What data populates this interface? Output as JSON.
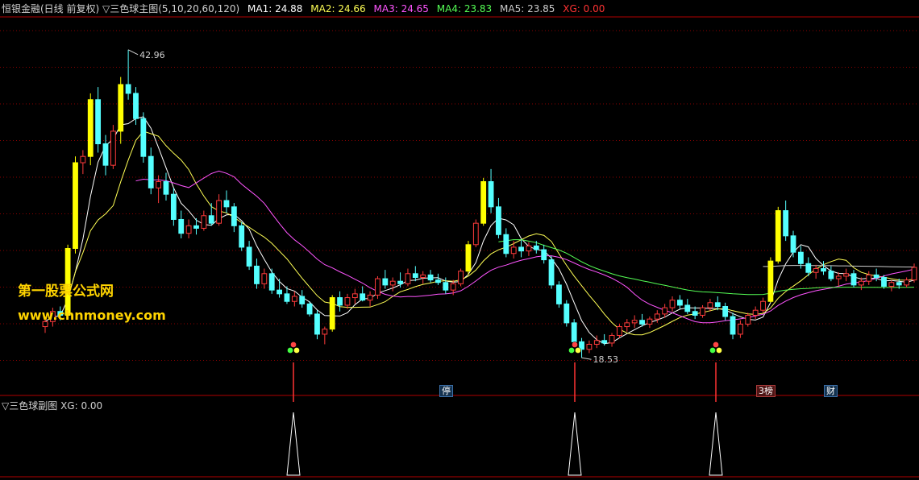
{
  "header": {
    "title": "恒银金融(日线 前复权) ▽三色球主图(5,10,20,60,120)",
    "ma1_label": "MA1: 24.88",
    "ma2_label": "MA2: 24.66",
    "ma3_label": "MA3: 24.65",
    "ma4_label": "MA4: 23.83",
    "ma5_label": "MA5: 23.85",
    "xg_label": "XG: 0.00"
  },
  "sub_header": {
    "title": "▽三色球副图",
    "xg_label": "XG: 0.00"
  },
  "watermark": {
    "line1": "第一股票公式网",
    "line2": "www.chnmoney.com"
  },
  "colors": {
    "up": "#ff3b3b",
    "down": "#55ffff",
    "yellow_candle": "#ffff00",
    "ma1": "#ffffff",
    "ma2": "#ffff55",
    "ma3": "#ff55ff",
    "ma4": "#55ff55",
    "ma5": "#cccccc",
    "grid": "#8b0000",
    "text": "#d0d0d0",
    "xg": "#ff3333"
  },
  "badges": [
    {
      "text": "停",
      "color": "blue",
      "pos": 553
    },
    {
      "text": "3榜",
      "color": "red",
      "pos": 946
    },
    {
      "text": "财",
      "color": "blue",
      "pos": 1030
    }
  ],
  "chart_data": {
    "type": "candlestick",
    "title": "恒银金融(日线 前复权)",
    "annotations": [
      {
        "text": "42.96",
        "kind": "high"
      },
      {
        "text": "18.53",
        "kind": "low"
      }
    ],
    "signals": [
      364,
      713,
      888
    ],
    "ylim": [
      16.5,
      45.5
    ],
    "candles": [
      [
        21.0,
        21.8,
        20.5,
        21.4
      ],
      [
        21.4,
        22.5,
        21.0,
        22.2
      ],
      [
        22.2,
        22.6,
        21.5,
        21.9
      ],
      [
        21.9,
        27.5,
        21.7,
        27.2
      ],
      [
        27.2,
        34.5,
        26.8,
        34.0
      ],
      [
        34.0,
        35.0,
        33.1,
        34.5
      ],
      [
        34.5,
        39.5,
        33.8,
        39.0
      ],
      [
        39.0,
        40.0,
        34.8,
        35.5
      ],
      [
        35.5,
        36.2,
        33.0,
        33.8
      ],
      [
        33.8,
        37.0,
        33.5,
        36.5
      ],
      [
        36.5,
        40.8,
        35.5,
        40.2
      ],
      [
        40.2,
        42.96,
        39.0,
        39.5
      ],
      [
        39.5,
        40.0,
        37.0,
        37.5
      ],
      [
        37.5,
        38.0,
        34.0,
        34.5
      ],
      [
        34.5,
        35.2,
        31.5,
        32.0
      ],
      [
        32.0,
        33.0,
        30.8,
        32.5
      ],
      [
        32.5,
        33.2,
        31.0,
        31.5
      ],
      [
        31.5,
        32.0,
        29.0,
        29.5
      ],
      [
        29.5,
        30.2,
        28.0,
        28.4
      ],
      [
        28.4,
        29.5,
        28.0,
        29.0
      ],
      [
        29.0,
        29.6,
        28.3,
        28.8
      ],
      [
        28.8,
        30.2,
        28.6,
        29.8
      ],
      [
        29.8,
        30.8,
        29.0,
        29.2
      ],
      [
        29.2,
        31.5,
        29.0,
        31.0
      ],
      [
        31.0,
        31.8,
        30.0,
        30.5
      ],
      [
        30.5,
        30.8,
        28.5,
        29.0
      ],
      [
        29.0,
        29.3,
        27.0,
        27.3
      ],
      [
        27.3,
        27.8,
        25.5,
        25.8
      ],
      [
        25.8,
        26.4,
        24.0,
        24.4
      ],
      [
        24.4,
        25.6,
        24.0,
        25.2
      ],
      [
        25.2,
        25.6,
        23.6,
        23.9
      ],
      [
        23.9,
        24.8,
        23.3,
        23.6
      ],
      [
        23.6,
        24.2,
        22.8,
        23.0
      ],
      [
        23.0,
        23.8,
        22.6,
        23.4
      ],
      [
        23.4,
        23.9,
        22.5,
        22.8
      ],
      [
        22.8,
        23.0,
        21.8,
        22.0
      ],
      [
        22.0,
        22.3,
        20.0,
        20.4
      ],
      [
        20.4,
        21.0,
        19.6,
        20.8
      ],
      [
        20.8,
        23.5,
        20.6,
        23.3
      ],
      [
        23.3,
        23.8,
        22.2,
        22.7
      ],
      [
        22.7,
        23.6,
        22.4,
        23.3
      ],
      [
        23.3,
        24.0,
        22.8,
        23.6
      ],
      [
        23.6,
        24.2,
        23.0,
        23.1
      ],
      [
        23.1,
        23.8,
        22.6,
        23.5
      ],
      [
        23.5,
        25.0,
        23.2,
        24.8
      ],
      [
        24.8,
        25.5,
        24.0,
        24.3
      ],
      [
        24.3,
        24.9,
        23.8,
        24.6
      ],
      [
        24.6,
        25.3,
        24.1,
        24.4
      ],
      [
        24.4,
        25.6,
        24.2,
        25.2
      ],
      [
        25.2,
        25.8,
        24.6,
        24.9
      ],
      [
        24.9,
        25.4,
        24.4,
        25.1
      ],
      [
        25.1,
        25.5,
        24.5,
        24.7
      ],
      [
        24.7,
        25.2,
        24.3,
        24.5
      ],
      [
        24.5,
        24.9,
        23.6,
        23.9
      ],
      [
        23.9,
        24.7,
        23.5,
        24.4
      ],
      [
        24.4,
        25.6,
        24.2,
        25.4
      ],
      [
        25.4,
        27.8,
        25.1,
        27.5
      ],
      [
        27.5,
        29.5,
        27.3,
        29.2
      ],
      [
        29.2,
        32.8,
        29.0,
        32.5
      ],
      [
        32.5,
        33.5,
        30.0,
        30.5
      ],
      [
        30.5,
        31.2,
        28.0,
        28.3
      ],
      [
        28.3,
        28.8,
        26.5,
        26.8
      ],
      [
        26.8,
        27.8,
        26.4,
        27.3
      ],
      [
        27.3,
        27.9,
        26.5,
        27.0
      ],
      [
        27.0,
        27.7,
        26.6,
        27.4
      ],
      [
        27.4,
        27.8,
        26.8,
        27.1
      ],
      [
        27.1,
        27.5,
        26.0,
        26.3
      ],
      [
        26.3,
        26.6,
        24.0,
        24.3
      ],
      [
        24.3,
        24.6,
        22.5,
        22.8
      ],
      [
        22.8,
        23.1,
        21.0,
        21.3
      ],
      [
        21.3,
        21.6,
        19.5,
        19.8
      ],
      [
        19.8,
        20.1,
        18.53,
        19.2
      ],
      [
        19.2,
        19.9,
        18.9,
        19.6
      ],
      [
        19.6,
        20.3,
        19.3,
        19.9
      ],
      [
        19.9,
        20.4,
        19.5,
        19.7
      ],
      [
        19.7,
        20.5,
        19.4,
        20.3
      ],
      [
        20.3,
        21.2,
        20.1,
        21.0
      ],
      [
        21.0,
        21.6,
        20.6,
        21.3
      ],
      [
        21.3,
        21.9,
        20.9,
        21.5
      ],
      [
        21.5,
        22.0,
        21.0,
        21.2
      ],
      [
        21.2,
        21.8,
        20.9,
        21.6
      ],
      [
        21.6,
        22.3,
        21.3,
        22.0
      ],
      [
        22.0,
        22.8,
        21.7,
        22.5
      ],
      [
        22.5,
        23.4,
        22.2,
        23.1
      ],
      [
        23.1,
        23.5,
        22.4,
        22.7
      ],
      [
        22.7,
        23.2,
        22.0,
        22.2
      ],
      [
        22.2,
        22.6,
        21.6,
        21.9
      ],
      [
        21.9,
        22.7,
        21.7,
        22.5
      ],
      [
        22.5,
        23.2,
        22.2,
        22.9
      ],
      [
        22.9,
        23.4,
        22.3,
        22.6
      ],
      [
        22.6,
        22.9,
        21.5,
        21.8
      ],
      [
        21.8,
        22.1,
        20.0,
        20.4
      ],
      [
        20.4,
        21.5,
        20.1,
        21.2
      ],
      [
        21.2,
        22.1,
        21.0,
        21.9
      ],
      [
        21.9,
        22.6,
        21.6,
        22.3
      ],
      [
        22.3,
        23.3,
        22.1,
        23.0
      ],
      [
        23.0,
        26.5,
        22.9,
        26.2
      ],
      [
        26.2,
        30.5,
        26.0,
        30.2
      ],
      [
        30.2,
        31.0,
        27.8,
        28.2
      ],
      [
        28.2,
        28.6,
        26.5,
        26.9
      ],
      [
        26.9,
        27.4,
        25.6,
        26.0
      ],
      [
        26.0,
        26.5,
        25.0,
        25.3
      ],
      [
        25.3,
        25.9,
        24.8,
        25.6
      ],
      [
        25.6,
        26.2,
        25.1,
        25.4
      ],
      [
        25.4,
        25.8,
        24.6,
        24.8
      ],
      [
        24.8,
        25.3,
        24.2,
        25.0
      ],
      [
        25.0,
        25.6,
        24.6,
        25.2
      ],
      [
        25.2,
        25.5,
        24.1,
        24.3
      ],
      [
        24.3,
        24.9,
        23.9,
        24.6
      ],
      [
        24.6,
        25.4,
        24.3,
        25.1
      ],
      [
        25.1,
        25.6,
        24.6,
        24.9
      ],
      [
        24.9,
        25.1,
        24.0,
        24.2
      ],
      [
        24.2,
        24.7,
        23.8,
        24.5
      ],
      [
        24.5,
        24.8,
        24.0,
        24.3
      ],
      [
        24.3,
        24.9,
        24.1,
        24.7
      ],
      [
        24.7,
        26.0,
        24.5,
        25.7
      ]
    ]
  }
}
